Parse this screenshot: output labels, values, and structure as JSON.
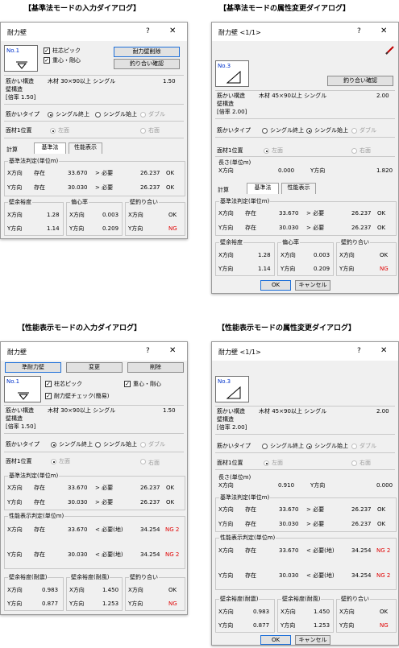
{
  "sections": {
    "a": "【基準法モードの入力ダイアログ】",
    "b": "【基準法モードの属性変更ダイアログ】",
    "c": "【性能表示モードの入力ダイアログ】",
    "d": "【性能表示モードの属性変更ダイアログ】"
  },
  "title": {
    "input": "耐力壁",
    "attr": "耐力壁 <1/1>"
  },
  "glyph": {
    "help": "?",
    "close": "✕"
  },
  "thumb": {
    "input": "No.1",
    "attr": "No.3"
  },
  "btn": {
    "delete_wall": "耐力壁削除",
    "balance": "釣り合い確認",
    "proposal": "準耐力壁",
    "change": "変更",
    "delete": "削除",
    "ok": "OK",
    "cancel": "キャンセル"
  },
  "chk": {
    "pillar": "柱芯ピック",
    "center": "重心・剛心",
    "perf_wall": "耐力壁チェック(簡易)"
  },
  "brace": {
    "label": "筋かい構造",
    "input_spec": "木材 30×90以上 シングル",
    "attr_spec": "木材 45×90以上 シングル",
    "input_val": "1.50",
    "attr_val": "2.00",
    "wall": "壁構造",
    "input_rate": "[倍率 1.50]",
    "attr_rate": "[倍率 2.00]"
  },
  "btype": {
    "label": "筋かいタイプ",
    "single_up": "シングル終上",
    "single_down": "シングル始上",
    "double": "ダブル"
  },
  "face": {
    "label": "面材1位置",
    "left": "左面",
    "right": "右面"
  },
  "length": {
    "label": "長さ(単位m)",
    "x": "X方向",
    "x_val": "0.000",
    "x_val2": "0.910",
    "y": "Y方向",
    "y_val": "1.820",
    "y_val2": "0.000"
  },
  "calc": {
    "label": "計算",
    "tab_std": "基準法",
    "tab_perf": "性能表示"
  },
  "std": {
    "title": "基準法判定(単位m)",
    "x": "X方向",
    "y": "Y方向",
    "exist": "存在",
    "xv": "33.670",
    "yv": "30.030",
    "gt": "> 必要",
    "lt": "< 必要(地)",
    "nx": "26.237",
    "ny": "26.237",
    "ok": "OK"
  },
  "perf": {
    "title": "性能表示判定(単位m)",
    "px": "34.254",
    "py": "34.254",
    "ng2": "NG 2"
  },
  "margin": {
    "title": "壁余裕度",
    "x": "1.28",
    "y": "1.14",
    "eq": "壁余裕度(耐震)",
    "wind": "壁余裕度(耐風)",
    "eqx": "0.983",
    "eqy": "0.877",
    "wx": "1.450",
    "wy": "1.253"
  },
  "ecc": {
    "title": "偏心率",
    "x": "0.003",
    "y": "0.209"
  },
  "bal": {
    "title": "壁釣り合い",
    "x": "OK",
    "y": "NG"
  }
}
